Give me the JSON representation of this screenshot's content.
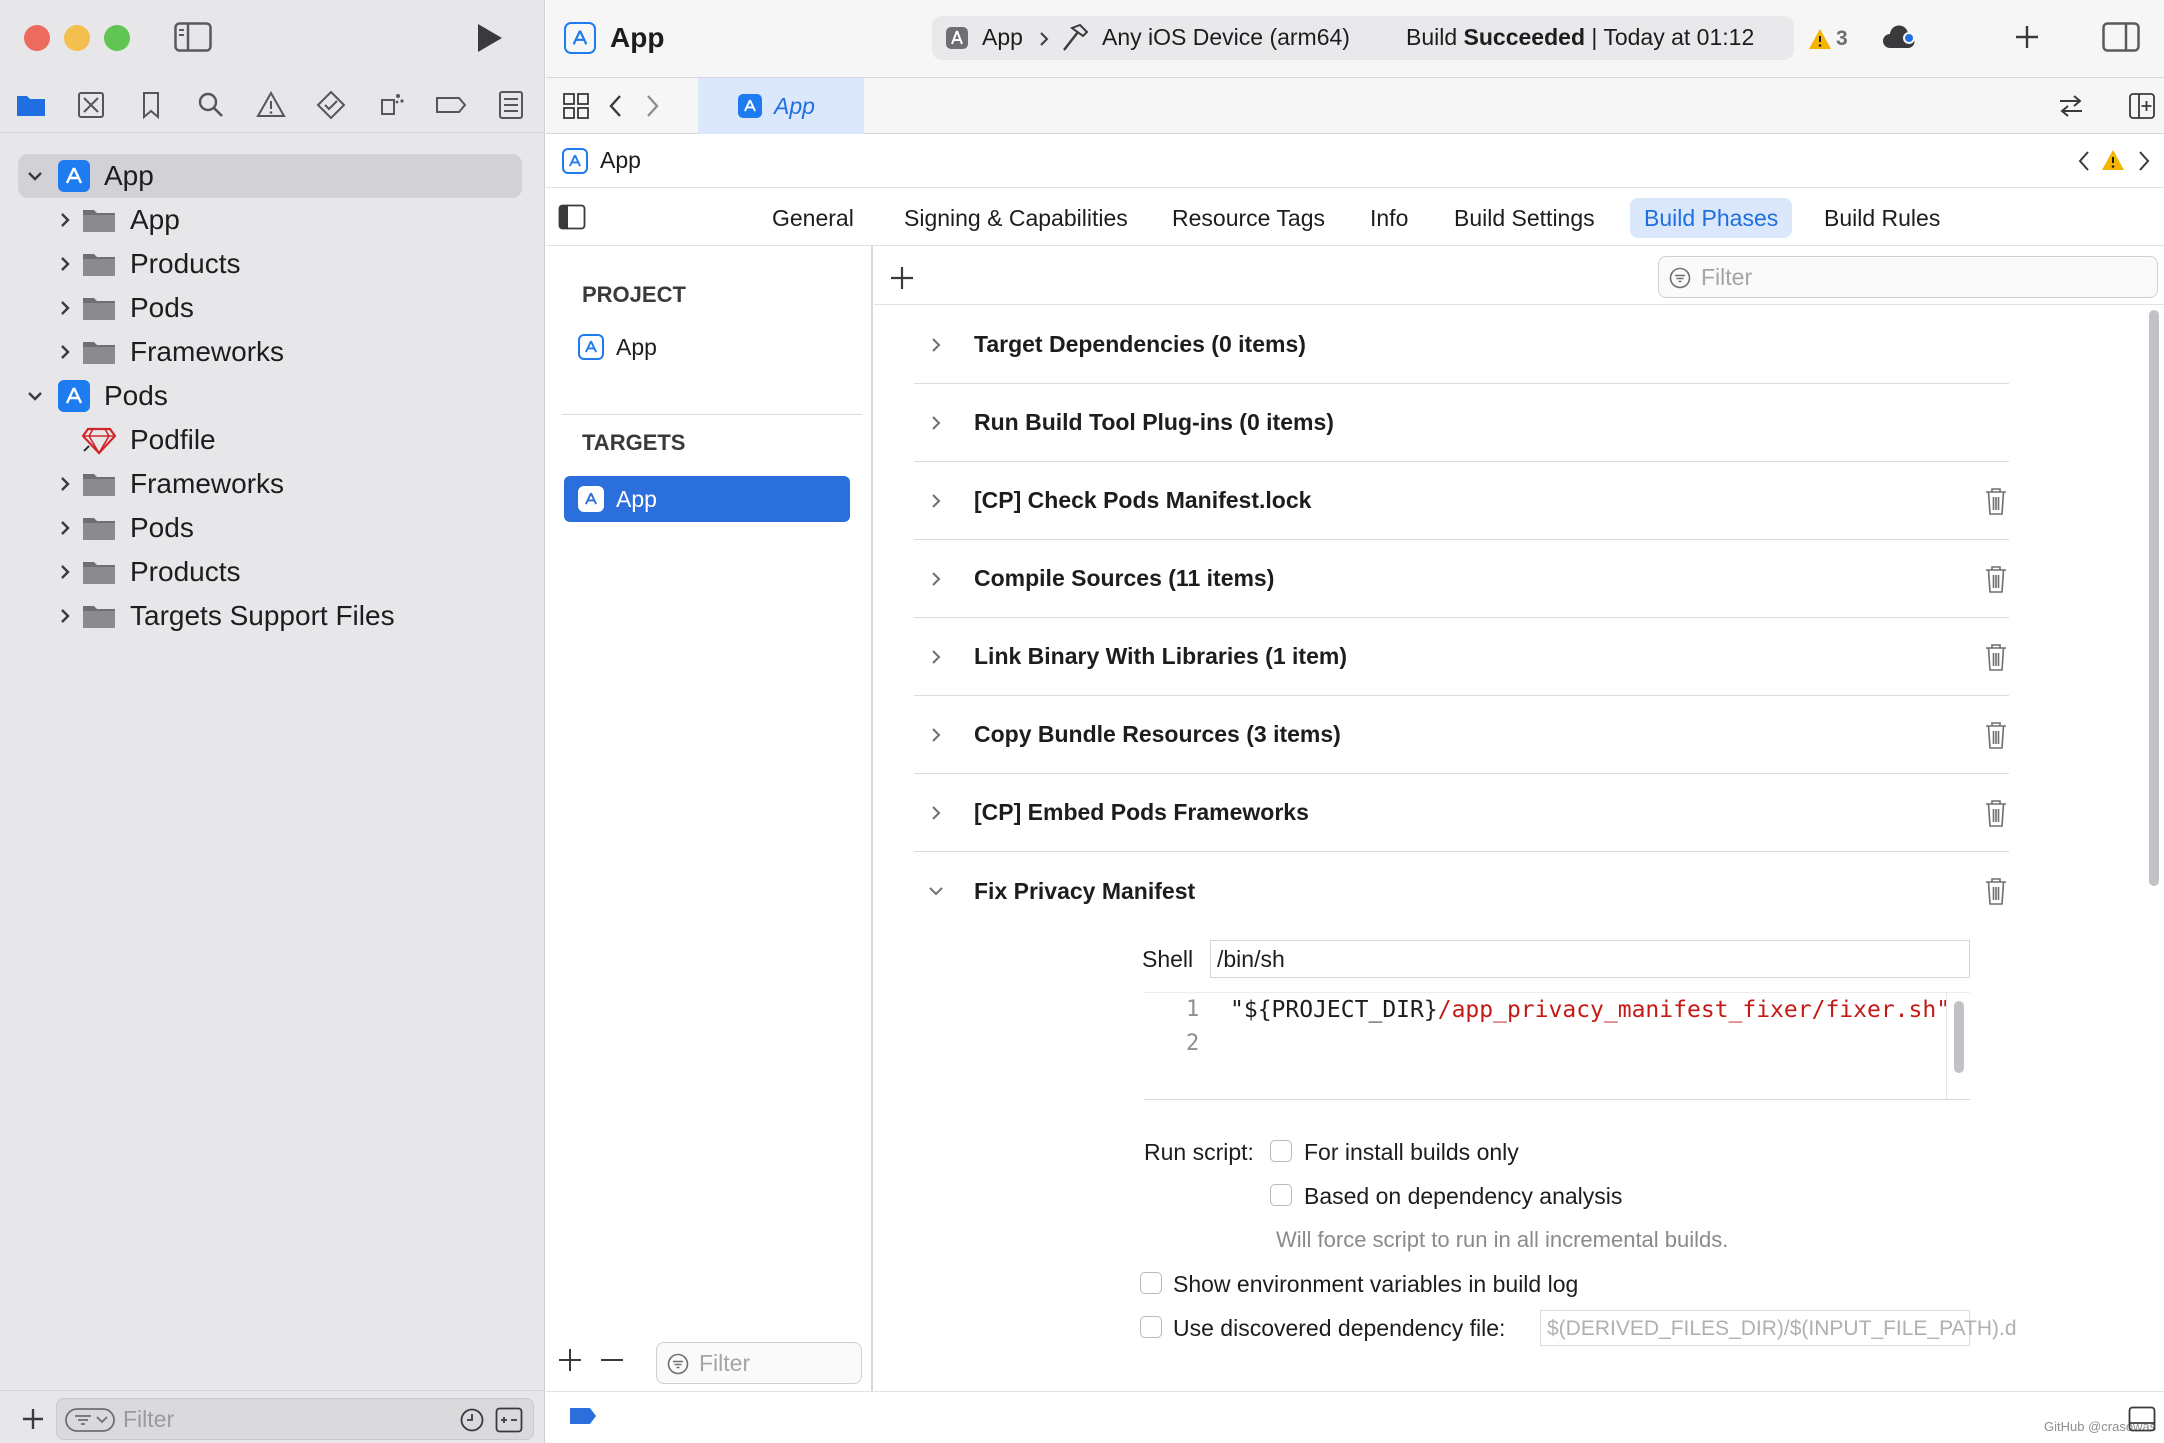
{
  "window": {
    "title": "App",
    "scheme": "App",
    "destination": "Any iOS Device (arm64)",
    "status_prefix": "Build",
    "status_strong": "Succeeded",
    "status_time": "Today at 01:12",
    "warning_count": "3"
  },
  "navigator": {
    "tree": [
      {
        "label": "App",
        "kind": "project",
        "expanded": true
      },
      {
        "label": "App",
        "kind": "folder"
      },
      {
        "label": "Products",
        "kind": "folder"
      },
      {
        "label": "Pods",
        "kind": "folder"
      },
      {
        "label": "Frameworks",
        "kind": "folder"
      },
      {
        "label": "Pods",
        "kind": "project",
        "expanded": true
      },
      {
        "label": "Podfile",
        "kind": "file"
      },
      {
        "label": "Frameworks",
        "kind": "folder"
      },
      {
        "label": "Pods",
        "kind": "folder"
      },
      {
        "label": "Products",
        "kind": "folder"
      },
      {
        "label": "Targets Support Files",
        "kind": "folder"
      }
    ],
    "filter_placeholder": "Filter"
  },
  "editor": {
    "open_tab": "App",
    "jump_bar": "App",
    "tabs": [
      "General",
      "Signing & Capabilities",
      "Resource Tags",
      "Info",
      "Build Settings",
      "Build Phases",
      "Build Rules"
    ],
    "active_tab": "Build Phases",
    "filter_placeholder": "Filter"
  },
  "targets_pane": {
    "project_header": "PROJECT",
    "project_item": "App",
    "targets_header": "TARGETS",
    "target_item": "App",
    "filter_placeholder": "Filter"
  },
  "phases": [
    {
      "title": "Target Dependencies (0 items)",
      "deletable": false
    },
    {
      "title": "Run Build Tool Plug-ins (0 items)",
      "deletable": false
    },
    {
      "title": "[CP] Check Pods Manifest.lock",
      "deletable": true
    },
    {
      "title": "Compile Sources (11 items)",
      "deletable": true
    },
    {
      "title": "Link Binary With Libraries (1 item)",
      "deletable": true
    },
    {
      "title": "Copy Bundle Resources (3 items)",
      "deletable": true
    },
    {
      "title": "[CP] Embed Pods Frameworks",
      "deletable": true
    },
    {
      "title": "Fix Privacy Manifest",
      "deletable": true,
      "expanded": true
    }
  ],
  "script_phase": {
    "shell_label": "Shell",
    "shell_value": "/bin/sh",
    "line_numbers": [
      "1",
      "2"
    ],
    "code_line_1_plain": "\"${PROJECT_DIR}",
    "code_line_1_path": "/app_privacy_manifest_fixer/fixer.sh\"",
    "run_script_label": "Run script:",
    "opt_install_only": "For install builds only",
    "opt_dependency_analysis": "Based on dependency analysis",
    "dependency_note": "Will force script to run in all incremental builds.",
    "opt_show_env": "Show environment variables in build log",
    "opt_discovered_dep": "Use discovered dependency file:",
    "dep_file_placeholder": "$(DERIVED_FILES_DIR)/$(INPUT_FILE_PATH).d"
  },
  "watermark": "GitHub @crasowas",
  "colors": {
    "accent": "#1f6fe0",
    "selection": "#2a6fdb",
    "warning": "#f5b400",
    "code_path": "#c41a16"
  }
}
